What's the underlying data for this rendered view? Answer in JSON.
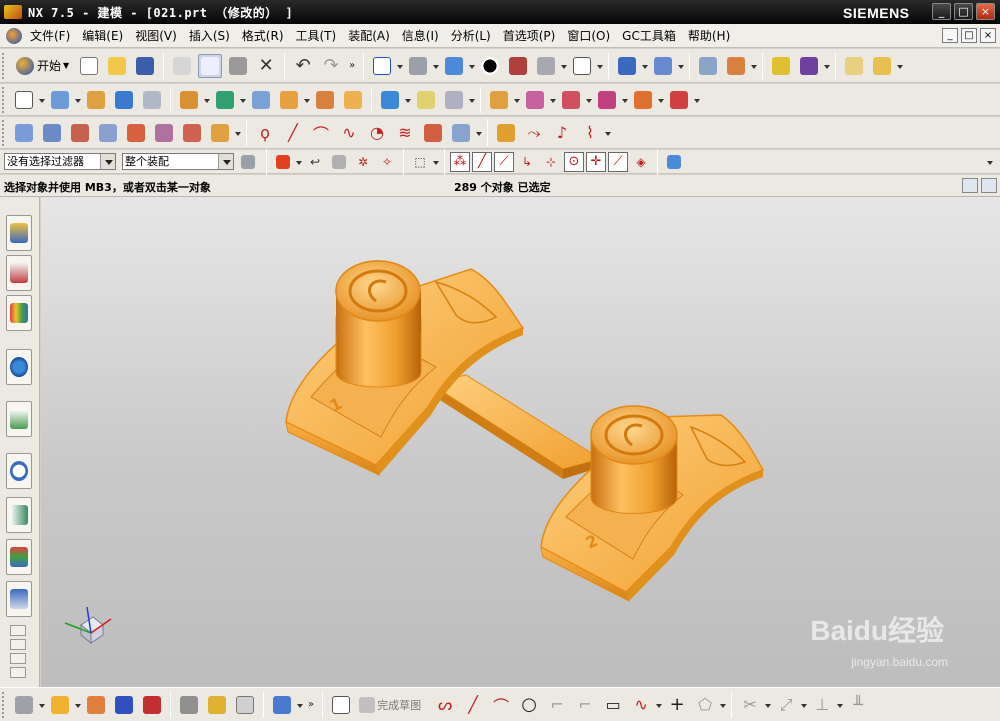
{
  "window": {
    "title": "NX 7.5 - 建模 - [021.prt （修改的） ]",
    "brand": "SIEMENS",
    "controls": [
      "_",
      "□",
      "×"
    ]
  },
  "menu": {
    "items": [
      "文件(F)",
      "编辑(E)",
      "视图(V)",
      "插入(S)",
      "格式(R)",
      "工具(T)",
      "装配(A)",
      "信息(I)",
      "分析(L)",
      "首选项(P)",
      "窗口(O)",
      "GC工具箱",
      "帮助(H)"
    ],
    "mdi_controls": [
      "_",
      "□",
      "×"
    ]
  },
  "toolbar_standard": {
    "start_label": "开始",
    "start_icon": "nx-start-icon",
    "more_glyph": "»"
  },
  "selection_bar": {
    "type_filter": "没有选择过滤器",
    "scope": "整个装配"
  },
  "status": {
    "prompt": "选择对象并使用 MB3，或者双击某一对象",
    "selection_count": "289 个对象 已选定"
  },
  "viewport": {
    "part_color": "#f5a33a",
    "background_top": "#e6e6e6",
    "background_bottom": "#bdbdbd",
    "engraved_labels": [
      "1",
      "2"
    ],
    "triad_label": "XYZ triad"
  },
  "bottom_toolbar": {
    "sketch_finish_label": "完成草图",
    "more_glyph": "»"
  },
  "watermark": {
    "logo_text": "Baidu经验",
    "url": "jingyan.baidu.com"
  }
}
